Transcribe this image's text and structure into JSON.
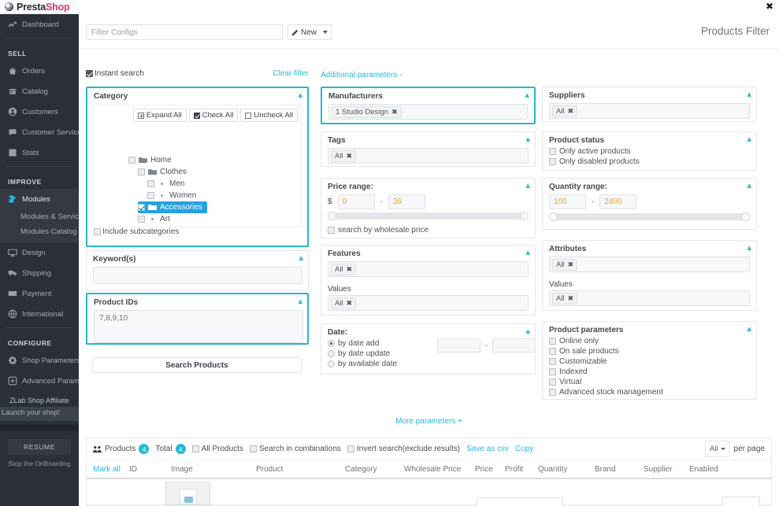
{
  "brand": {
    "name_dark": "Presta",
    "name_pink": "Shop"
  },
  "window": {
    "close_label": "✖"
  },
  "sidebar": {
    "top_items": [
      {
        "label": "Dashboard",
        "icon": "dashboard-icon"
      }
    ],
    "sections": [
      {
        "title": "SELL",
        "items": [
          {
            "label": "Orders",
            "icon": "orders-icon"
          },
          {
            "label": "Catalog",
            "icon": "catalog-icon"
          },
          {
            "label": "Customers",
            "icon": "customers-icon"
          },
          {
            "label": "Customer Service",
            "icon": "customer-service-icon"
          },
          {
            "label": "Stats",
            "icon": "stats-icon"
          }
        ]
      },
      {
        "title": "IMPROVE",
        "items": [
          {
            "label": "Modules",
            "icon": "modules-icon",
            "active": true
          },
          {
            "label": "Design",
            "icon": "design-icon"
          },
          {
            "label": "Shipping",
            "icon": "shipping-icon"
          },
          {
            "label": "Payment",
            "icon": "payment-icon"
          },
          {
            "label": "International",
            "icon": "international-icon"
          }
        ],
        "submenu": [
          "Modules & Services",
          "Modules Catalog"
        ]
      },
      {
        "title": "CONFIGURE",
        "items": [
          {
            "label": "Shop Parameters",
            "icon": "shop-parameters-icon"
          },
          {
            "label": "Advanced Parameters",
            "icon": "advanced-parameters-icon"
          }
        ]
      }
    ],
    "affiliate": "ZLab Shop Affiliate",
    "onboarding": {
      "title": "Launch your shop!",
      "resume_label": "RESUME",
      "stop_label": "Stop the OnBoarding"
    }
  },
  "header": {
    "filter_configs_placeholder": "Filter Configs",
    "filter_configs_value": "",
    "new_label": "New",
    "page_title": "Products Filter"
  },
  "toolbar": {
    "instant_search_label": "Instant search",
    "instant_search_checked": true,
    "clear_filter_label": "Clear filter",
    "additional_parameters_label": "Additional parameters -"
  },
  "category": {
    "title": "Category",
    "expand_all": "Expand All",
    "check_all": "Check All",
    "uncheck_all": "Uncheck All",
    "tree": [
      {
        "label": "Home",
        "depth": 0,
        "type": "folder",
        "checked": false,
        "selected": false
      },
      {
        "label": "Clothes",
        "depth": 1,
        "type": "folder",
        "checked": false,
        "selected": false
      },
      {
        "label": "Men",
        "depth": 2,
        "type": "leaf",
        "checked": false,
        "selected": false
      },
      {
        "label": "Women",
        "depth": 2,
        "type": "leaf",
        "checked": false,
        "selected": false
      },
      {
        "label": "Accessories",
        "depth": 1,
        "type": "folder",
        "checked": true,
        "selected": true
      },
      {
        "label": "Art",
        "depth": 1,
        "type": "leaf",
        "checked": false,
        "selected": false
      }
    ],
    "include_subcategories_label": "Include subcategories",
    "include_subcategories_checked": false
  },
  "keywords": {
    "title": "Keyword(s)",
    "value": "",
    "placeholder": ""
  },
  "product_ids": {
    "title": "Product IDs",
    "value": "7,8,9,10"
  },
  "search_products_label": "Search Products",
  "manufacturers": {
    "title": "Manufacturers",
    "tags": [
      "1 Studio Design"
    ]
  },
  "tags": {
    "title": "Tags",
    "tags": [
      "All"
    ]
  },
  "price_range": {
    "title": "Price range:",
    "currency": "$",
    "min": "0",
    "max": "36",
    "wholesale_label": "search by wholesale price",
    "wholesale_checked": false
  },
  "features": {
    "title": "Features",
    "tags": [
      "All"
    ],
    "values_label": "Values",
    "values_tags": [
      "All"
    ]
  },
  "date": {
    "title": "Date:",
    "options": [
      {
        "label": "by date add",
        "checked": true
      },
      {
        "label": "by date update",
        "checked": false
      },
      {
        "label": "by available date",
        "checked": false
      }
    ],
    "from": "",
    "to": ""
  },
  "suppliers": {
    "title": "Suppliers",
    "tags": [
      "All"
    ]
  },
  "product_status": {
    "title": "Product status",
    "options": [
      {
        "label": "Only active products",
        "checked": false
      },
      {
        "label": "Only disabled products",
        "checked": false
      }
    ]
  },
  "quantity_range": {
    "title": "Quantity range:",
    "min": "100",
    "max": "2400"
  },
  "attributes": {
    "title": "Attributes",
    "tags": [
      "All"
    ],
    "values_label": "Values",
    "values_tags": [
      "All"
    ]
  },
  "product_parameters": {
    "title": "Product parameters",
    "options": [
      {
        "label": "Online only",
        "checked": false
      },
      {
        "label": "On sale products",
        "checked": false
      },
      {
        "label": "Customizable",
        "checked": false
      },
      {
        "label": "Indexed",
        "checked": false
      },
      {
        "label": "Virtual",
        "checked": false
      },
      {
        "label": "Advanced stock management",
        "checked": false
      }
    ]
  },
  "more_parameters_label": "More parameters +",
  "results": {
    "products_label": "Products",
    "products_count": "4",
    "total_label": "Total",
    "total_count": "4",
    "all_products_label": "All Products",
    "search_in_combinations_label": "Search in combinations",
    "invert_search_label": "Invert search(exclude results)",
    "save_as_csv_label": "Save as csv",
    "copy_label": "Copy",
    "per_page_value": "All",
    "per_page_label": "per page",
    "columns": [
      "Mark all",
      "ID",
      "Image",
      "Product",
      "Category",
      "Wholesale Price",
      "Price",
      "Profit",
      "Quantity",
      "Brand",
      "Supplier",
      "Enabled"
    ]
  }
}
